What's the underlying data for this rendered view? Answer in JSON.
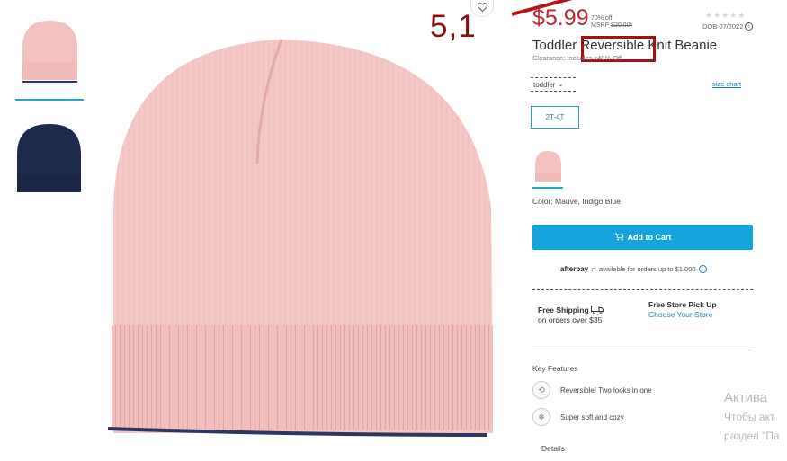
{
  "annotation": {
    "number": "5,1"
  },
  "price": {
    "current": "$5.99",
    "percent_off": "70% off",
    "msrp_label": "MSRP",
    "msrp_value": "$20.00*"
  },
  "rating": {
    "stars": "★★★★★"
  },
  "dob": {
    "text": "DOB 07/2022",
    "info": "i"
  },
  "product": {
    "title": "Toddler Reversible Knit Beanie",
    "clearance": "Clearance: Includes x40% Off"
  },
  "size": {
    "dropdown_label": "toddler",
    "size_chart": "size chart",
    "selected": "2T-4T"
  },
  "color": {
    "label": "Color: Mauve, Indigo Blue"
  },
  "cart": {
    "button_label": "Add to Cart"
  },
  "afterpay": {
    "brand": "afterpay",
    "text": "available for orders up to $1,000",
    "info": "i"
  },
  "shipping": {
    "title": "Free Shipping",
    "subtitle": "on orders over $35",
    "store_title": "Free Store Pick Up",
    "store_link": "Choose Your Store"
  },
  "key_features": {
    "title": "Key Features",
    "items": [
      {
        "icon": "reversible-icon",
        "text": "Reversible! Two looks in one"
      },
      {
        "icon": "snowflake-icon",
        "text": "Super soft and cozy"
      }
    ]
  },
  "details": {
    "label": "Details"
  },
  "windows_activation": {
    "line1": "Актива",
    "line2": "Чтобы акт",
    "line3": "раздел \"Па"
  },
  "colors": {
    "accent": "#14a4da",
    "price_red": "#c0272d",
    "annotation_red": "#a80f0f",
    "beanie_pink": "#f2c2c0",
    "beanie_navy": "#1e2a4c"
  }
}
